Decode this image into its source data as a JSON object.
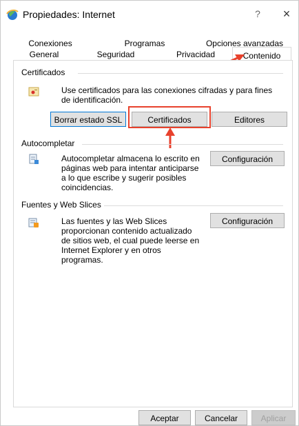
{
  "window": {
    "title": "Propiedades: Internet",
    "help_glyph": "?",
    "close_glyph": "×"
  },
  "tabs": {
    "top_row": [
      "Conexiones",
      "Programas",
      "Opciones avanzadas"
    ],
    "bottom_row": [
      "General",
      "Seguridad",
      "Privacidad",
      "Contenido"
    ],
    "active": "Contenido"
  },
  "certificados": {
    "title": "Certificados",
    "description": "Use certificados para las conexiones cifradas y para fines de identificación.",
    "buttons": [
      "Borrar estado SSL",
      "Certificados",
      "Editores"
    ],
    "icon": "certificate-icon"
  },
  "autocompletar": {
    "title": "Autocompletar",
    "description": "Autocompletar almacena lo escrito en páginas web para intentar anticiparse a lo que escribe y sugerir posibles coincidencias.",
    "button": "Configuración",
    "icon": "autocomplete-icon"
  },
  "fuentes": {
    "title": "Fuentes y Web Slices",
    "description": "Las fuentes y las Web Slices proporcionan contenido actualizado de sitios web, el cual puede leerse en Internet Explorer y en otros programas.",
    "button": "Configuración",
    "icon": "feeds-icon"
  },
  "footer": {
    "ok": "Aceptar",
    "cancel": "Cancelar",
    "apply": "Aplicar"
  },
  "annotation_color": "#e8412c"
}
